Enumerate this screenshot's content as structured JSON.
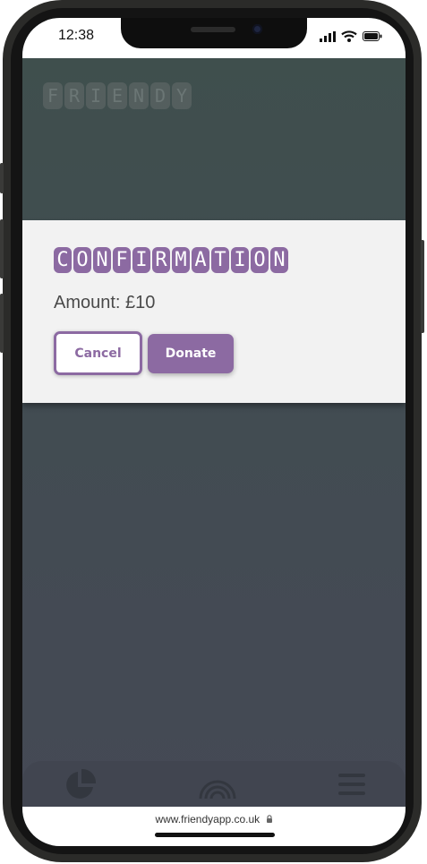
{
  "status_bar": {
    "time": "12:38",
    "icons": [
      "signal-icon",
      "wifi-icon",
      "battery-icon"
    ]
  },
  "app": {
    "logo_letters": [
      "F",
      "R",
      "I",
      "E",
      "N",
      "D",
      "Y"
    ]
  },
  "modal": {
    "title_letters": [
      "C",
      "O",
      "N",
      "F",
      "I",
      "R",
      "M",
      "A",
      "T",
      "I",
      "O",
      "N"
    ],
    "amount_text": "Amount: £10",
    "cancel_label": "Cancel",
    "donate_label": "Donate"
  },
  "bottom_nav": {
    "items": [
      "pie-chart-icon",
      "rainbow-icon",
      "menu-icon"
    ]
  },
  "browser": {
    "url": "www.friendyapp.co.uk",
    "lock_icon": "lock-icon"
  },
  "colors": {
    "accent": "#8c6aa2",
    "background": "#3f4a4e",
    "modal": "#f2f2f2"
  }
}
